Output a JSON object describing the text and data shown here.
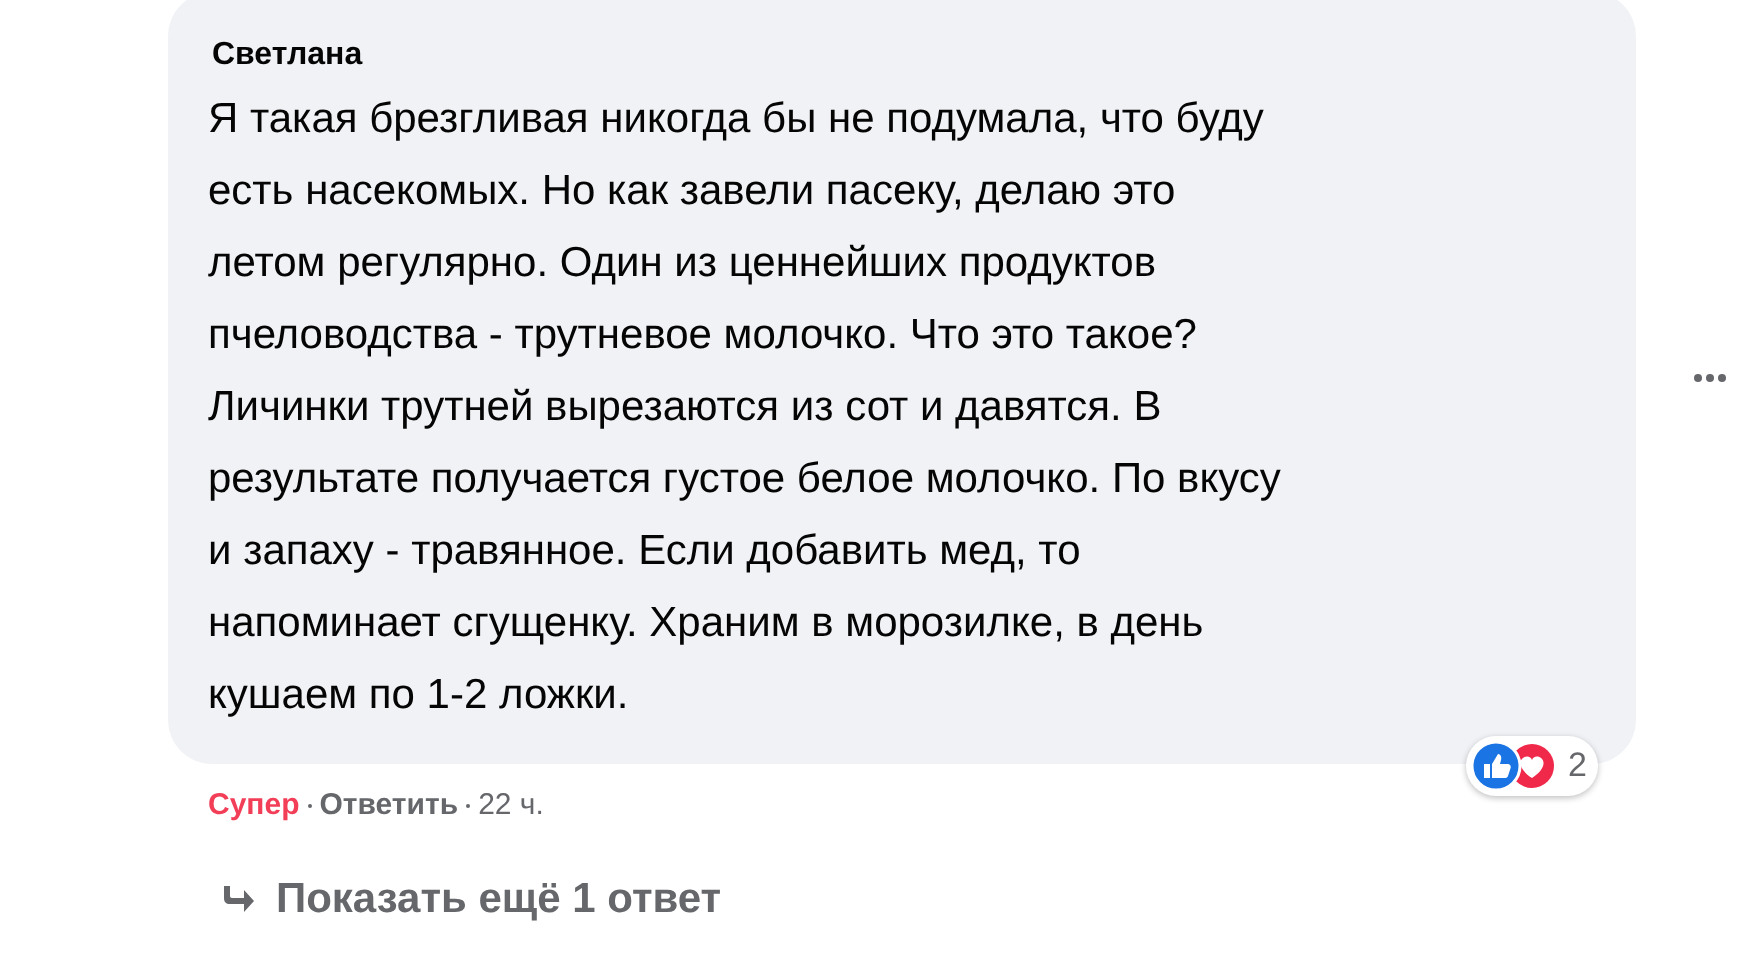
{
  "comment": {
    "author": "Светлана",
    "lines": [
      "Я такая брезгливая никогда бы не подумала, что буду",
      "есть насекомых. Но как завели пасеку, делаю это",
      "летом регулярно. Один из ценнейших продуктов",
      "пчеловодства - трутневое молочко. Что это такое?",
      "Личинки трутней вырезаются из сот и давятся. В",
      "результате получается густое белое молочко. По вкусу",
      "и запаху - травянное. Если добавить мед, то",
      "напоминает сгущенку. Храним в морозилке, в день",
      "кушаем по 1-2 ложки."
    ],
    "reaction": {
      "label": "Супер",
      "selected": true
    },
    "reply": "Ответить",
    "time": "22 ч.",
    "reaction_count": "2"
  },
  "more_replies": "Показать ещё 1 ответ"
}
